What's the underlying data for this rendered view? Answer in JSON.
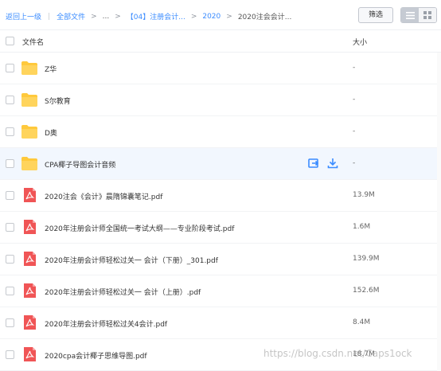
{
  "breadcrumb": {
    "back": "返回上一级",
    "sep": "|",
    "all_files": "全部文件",
    "arrow": ">",
    "ellipsis": "...",
    "folder1": "【04】注册会计...",
    "folder2": "2020",
    "current": "2020注会会计..."
  },
  "toolbar": {
    "filter_label": "筛选"
  },
  "columns": {
    "name": "文件名",
    "size": "大小"
  },
  "colors": {
    "link": "#3b8cff",
    "folder": "#ffc93c",
    "pdf": "#f05556",
    "hover_row": "#f2f7fe"
  },
  "files": [
    {
      "name": "Z华",
      "size": "-",
      "icon": "folder-icon"
    },
    {
      "name": "S尔教育",
      "size": "-",
      "icon": "folder-icon"
    },
    {
      "name": "D奥",
      "size": "-",
      "icon": "folder-icon"
    },
    {
      "name": "CPA椰子导图会计音频",
      "size": "-",
      "icon": "folder-icon"
    },
    {
      "name": "2020注会《会计》晨隋锦囊笔记.pdf",
      "size": "13.9M",
      "icon": "pdf-icon"
    },
    {
      "name": "2020年注册会计师全国统一考试大纲——专业阶段考试.pdf",
      "size": "1.6M",
      "icon": "pdf-icon"
    },
    {
      "name": "2020年注册会计师轻松过关一 会计（下册）_301.pdf",
      "size": "139.9M",
      "icon": "pdf-icon"
    },
    {
      "name": "2020年注册会计师轻松过关一 会计（上册）.pdf",
      "size": "152.6M",
      "icon": "pdf-icon"
    },
    {
      "name": "2020年注册会计师轻松过关4会计.pdf",
      "size": "8.4M",
      "icon": "pdf-icon"
    },
    {
      "name": "2020cpa会计椰子思维导图.pdf",
      "size": "18.7M",
      "icon": "pdf-icon"
    }
  ],
  "watermark": "https://blog.csdn.net/Caps1ock"
}
